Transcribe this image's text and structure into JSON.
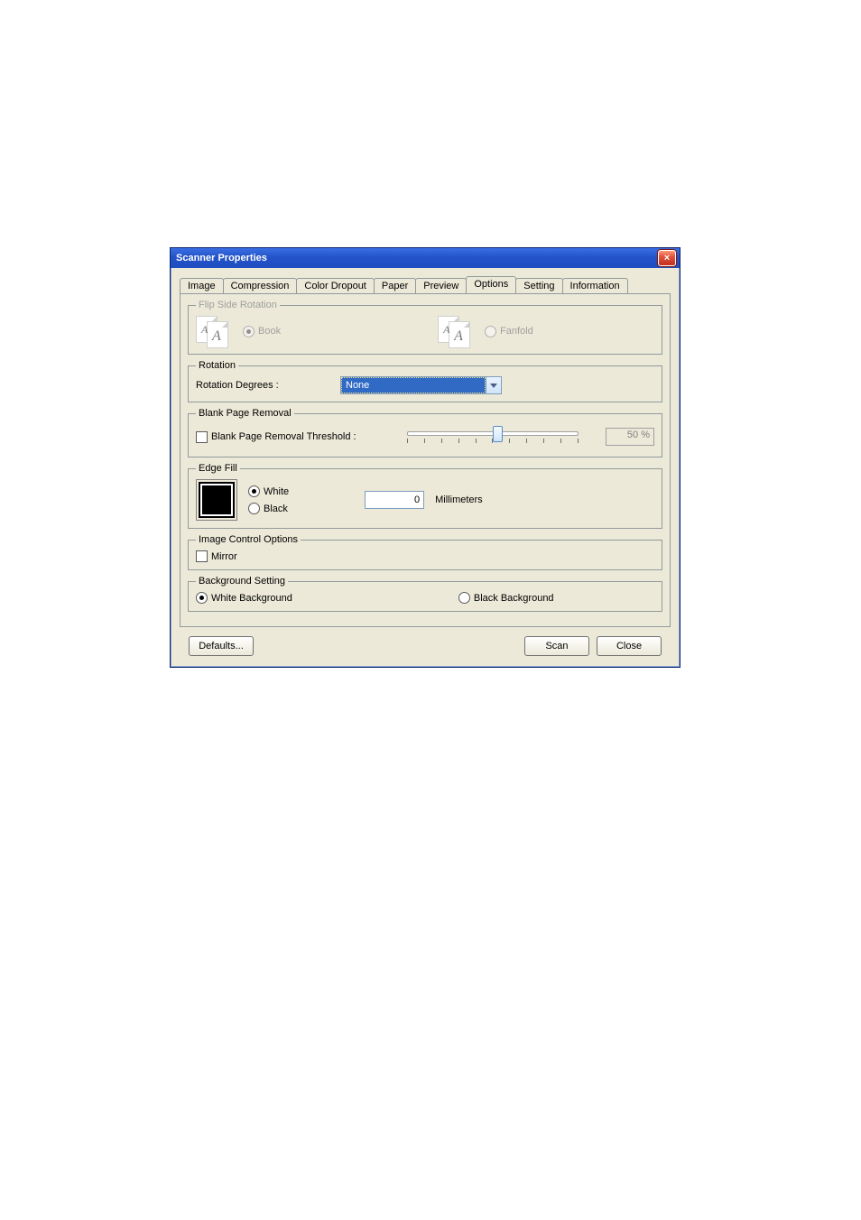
{
  "window": {
    "title": "Scanner Properties"
  },
  "tabs": {
    "image": "Image",
    "compression": "Compression",
    "color_dropout": "Color Dropout",
    "paper": "Paper",
    "preview": "Preview",
    "options": "Options",
    "setting": "Setting",
    "information": "Information",
    "selected": "Options"
  },
  "flip": {
    "legend": "Flip Side Rotation",
    "book": "Book",
    "fanfold": "Fanfold"
  },
  "rotation": {
    "legend": "Rotation",
    "label": "Rotation Degrees :",
    "value": "None"
  },
  "blank": {
    "legend": "Blank Page Removal",
    "checkbox": "Blank Page Removal Threshold :",
    "value": "50",
    "unit": "%"
  },
  "edge": {
    "legend": "Edge Fill",
    "white": "White",
    "black": "Black",
    "value": "0",
    "unit": "Millimeters"
  },
  "imgctrl": {
    "legend": "Image Control Options",
    "mirror": "Mirror"
  },
  "bg": {
    "legend": "Background Setting",
    "white": "White Background",
    "black": "Black Background"
  },
  "buttons": {
    "defaults": "Defaults...",
    "scan": "Scan",
    "close": "Close"
  }
}
